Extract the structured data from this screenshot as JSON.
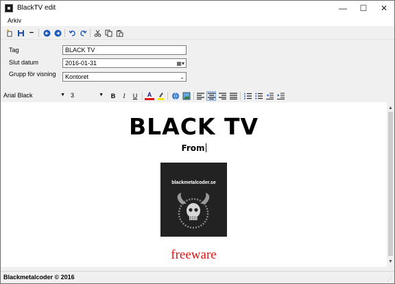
{
  "window": {
    "title": "BlackTV edit",
    "controls": {
      "minimize": "—",
      "maximize": "☐",
      "close": "✕"
    }
  },
  "menu": {
    "items": [
      "Arkiv"
    ]
  },
  "toolbar": {
    "icons": [
      "new-icon",
      "save-icon",
      "remove-icon",
      "back-icon",
      "forward-icon",
      "undo-icon",
      "redo-icon",
      "cut-icon",
      "copy-icon",
      "paste-icon"
    ],
    "remove_glyph": "−"
  },
  "form": {
    "tag_label": "Tag",
    "tag_value": "BLACK TV",
    "slut_label": "Slut datum",
    "slut_value": "2016-01-31",
    "grupp_label": "Grupp för visning",
    "grupp_value": "Kontoret"
  },
  "format_bar": {
    "font_name": "Arial Black",
    "font_size": "3",
    "bold": "B",
    "italic": "I",
    "underline": "U",
    "font_color_glyph": "A"
  },
  "editor": {
    "heading": "BLACK TV",
    "from_text": "From",
    "logo_text": "blackmetalcoder.se",
    "freeware_text": "freeware",
    "freeware_color": "#e01414"
  },
  "statusbar": {
    "text": "Blackmetalcoder © 2016",
    "grip": "⋰"
  }
}
